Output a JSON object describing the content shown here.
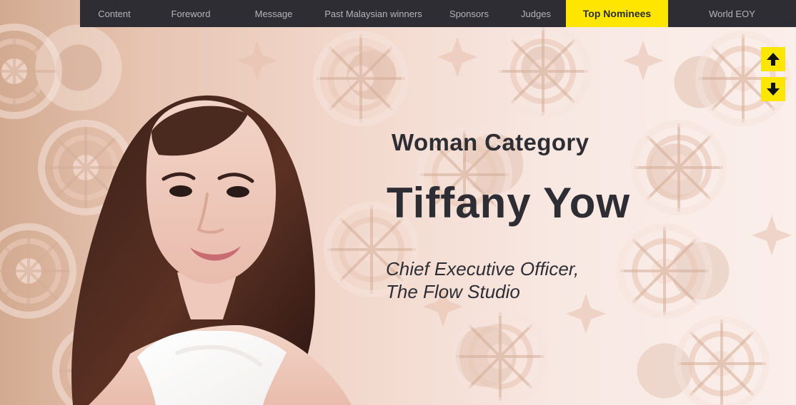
{
  "nav": {
    "items": [
      {
        "label": "Content",
        "active": false
      },
      {
        "label": "Foreword",
        "active": false
      },
      {
        "label": "Message",
        "active": false
      },
      {
        "label": "Past Malaysian winners",
        "active": false
      },
      {
        "label": "Sponsors",
        "active": false
      },
      {
        "label": "Judges",
        "active": false
      },
      {
        "label": "Top Nominees",
        "active": true
      },
      {
        "label": "World EOY",
        "active": false
      }
    ],
    "background": "#2e2d34",
    "active_color": "#ffe600"
  },
  "controls": {
    "up_icon": "arrow-up-icon",
    "down_icon": "arrow-down-icon",
    "color": "#ffe600"
  },
  "hero": {
    "category": "Woman Category",
    "name": "Tiffany Yow",
    "role_line_1": "Chief Executive Officer,",
    "role_line_2": "The Flow Studio"
  }
}
